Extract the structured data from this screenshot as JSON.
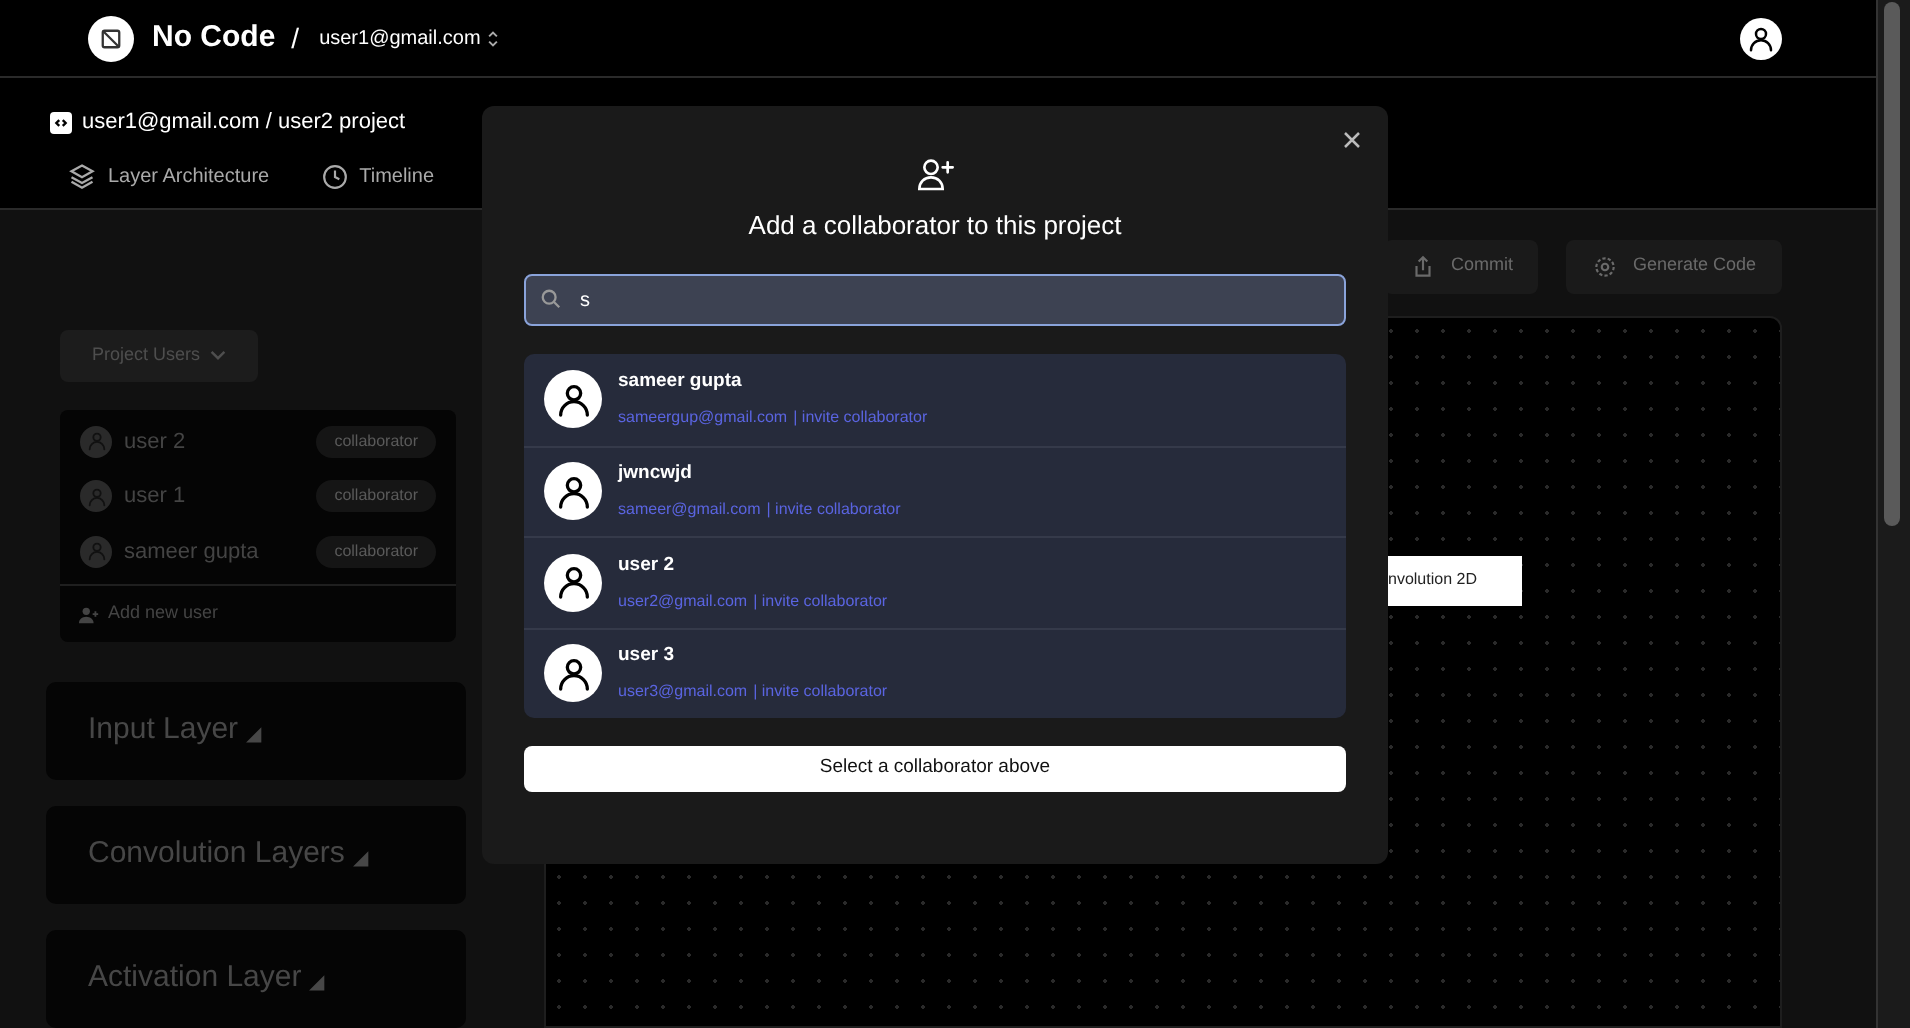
{
  "header": {
    "brand": "No Code",
    "separator": "/",
    "account": "user1@gmail.com"
  },
  "project": {
    "title": "user1@gmail.com / user2 project",
    "tabs": [
      {
        "label": "Layer Architecture",
        "kind": "layers"
      },
      {
        "label": "Timeline",
        "kind": "clock"
      }
    ]
  },
  "toolbar": {
    "buttons": [
      {
        "label": "Commit",
        "kind": "commit"
      },
      {
        "label": "Generate Code",
        "kind": "gear"
      }
    ]
  },
  "sidebar": {
    "users_button": "Project Users",
    "users": [
      {
        "name": "user 2",
        "role": "collaborator"
      },
      {
        "name": "user 1",
        "role": "collaborator"
      },
      {
        "name": "sameer gupta",
        "role": "collaborator"
      }
    ],
    "add_user": "Add new user",
    "layers": [
      {
        "label": "Input Layer",
        "marker": "◢"
      },
      {
        "label": "Convolution Layers",
        "marker": "◢"
      },
      {
        "label": "Activation Layer",
        "marker": "◢"
      }
    ]
  },
  "canvas": {
    "nodes": [
      {
        "label": "nvolution 2D"
      }
    ]
  },
  "dialog": {
    "title": "Add a collaborator to this project",
    "search": {
      "value": "s"
    },
    "results": [
      {
        "name": "sameer gupta",
        "email": "sameergup@gmail.com",
        "action": "| invite collaborator"
      },
      {
        "name": "jwncwjd",
        "email": "sameer@gmail.com",
        "action": "| invite collaborator"
      },
      {
        "name": "user 2",
        "email": "user2@gmail.com",
        "action": "| invite collaborator"
      },
      {
        "name": "user 3",
        "email": "user3@gmail.com",
        "action": "| invite collaborator"
      }
    ],
    "submit": "Select a collaborator above"
  }
}
